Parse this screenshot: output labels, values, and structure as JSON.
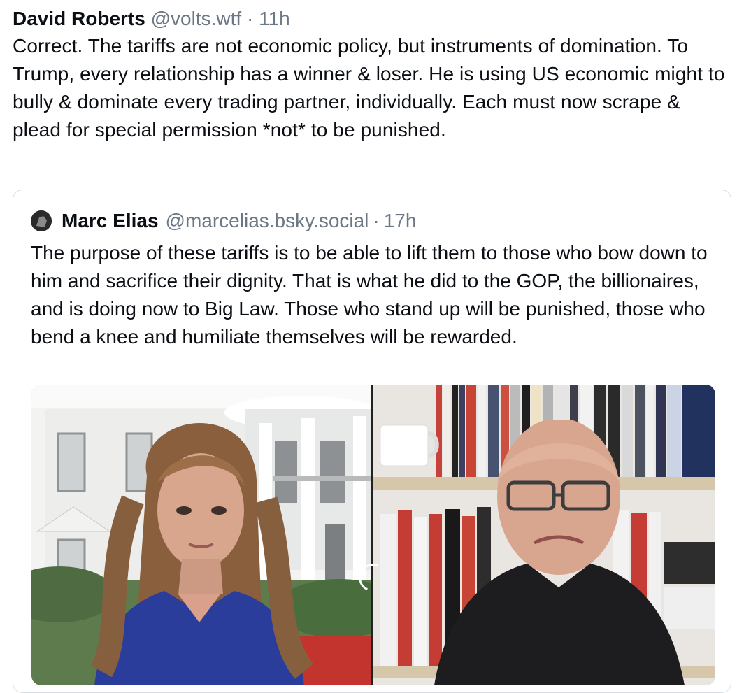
{
  "post": {
    "author_name": "David Roberts",
    "handle": "@volts.wtf",
    "separator": "·",
    "time": "11h",
    "text": "Correct. The tariffs are not economic policy, but instruments of domination. To Trump, every relationship has a winner & loser. He is using US economic might to bully & dominate every trading partner, individually. Each must now scrape & plead for special permission *not* to be punished."
  },
  "quote": {
    "author_name": "Marc Elias",
    "handle": "@marcelias.bsky.social",
    "separator": "·",
    "time": "17h",
    "text": "The purpose of these tariffs is to be able to lift them to those who bow down to him and sacrifice their dignity. That is what he did to the GOP, the billionaires, and is doing now to Big Law. Those who stand up will be punished, those who bend a knee and humiliate themselves will be rewarded."
  },
  "media": {
    "left_scene": "anchor in front of white house",
    "right_scene": "guest in front of bookshelves",
    "loading_icon": "loading-spinner-icon"
  }
}
